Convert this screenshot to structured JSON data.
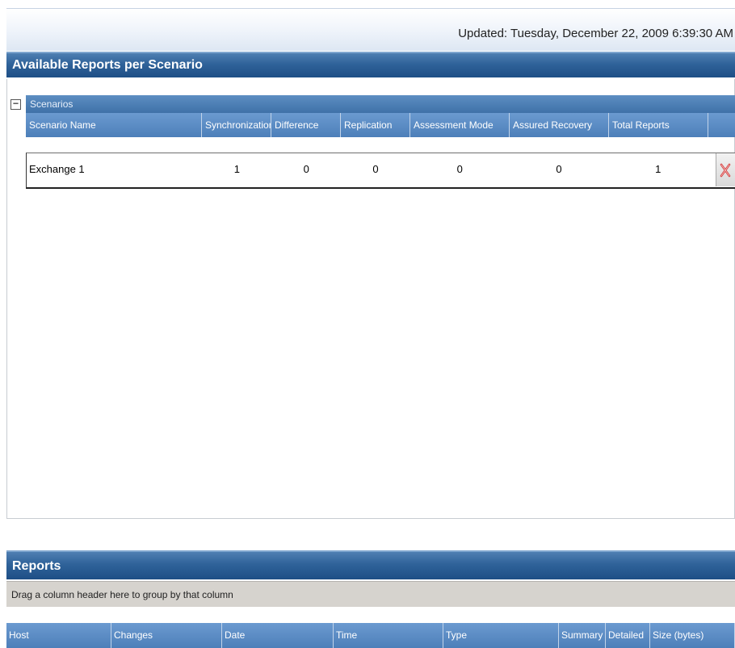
{
  "updated": "Updated: Tuesday, December 22, 2009 6:39:30 AM",
  "available_section": {
    "title": "Available Reports per Scenario",
    "group_label": "Scenarios",
    "collapse_glyph": "−",
    "columns": [
      "Scenario Name",
      "Synchronization",
      "Difference",
      "Replication",
      "Assessment Mode",
      "Assured Recovery",
      "Total Reports"
    ],
    "rows": [
      {
        "name": "Exchange 1",
        "synchronization": "1",
        "difference": "0",
        "replication": "0",
        "assessment_mode": "0",
        "assured_recovery": "0",
        "total_reports": "1",
        "action_icon": "delete-icon"
      }
    ]
  },
  "reports_section": {
    "title": "Reports",
    "group_hint": "Drag a column header here to group by that column",
    "columns": [
      "Host",
      "Changes",
      "Date",
      "Time",
      "Type",
      "Summary",
      "Detailed",
      "Size (bytes)"
    ]
  },
  "colors": {
    "header_blue": "#2f6299",
    "delete_red": "#d43b3b"
  }
}
